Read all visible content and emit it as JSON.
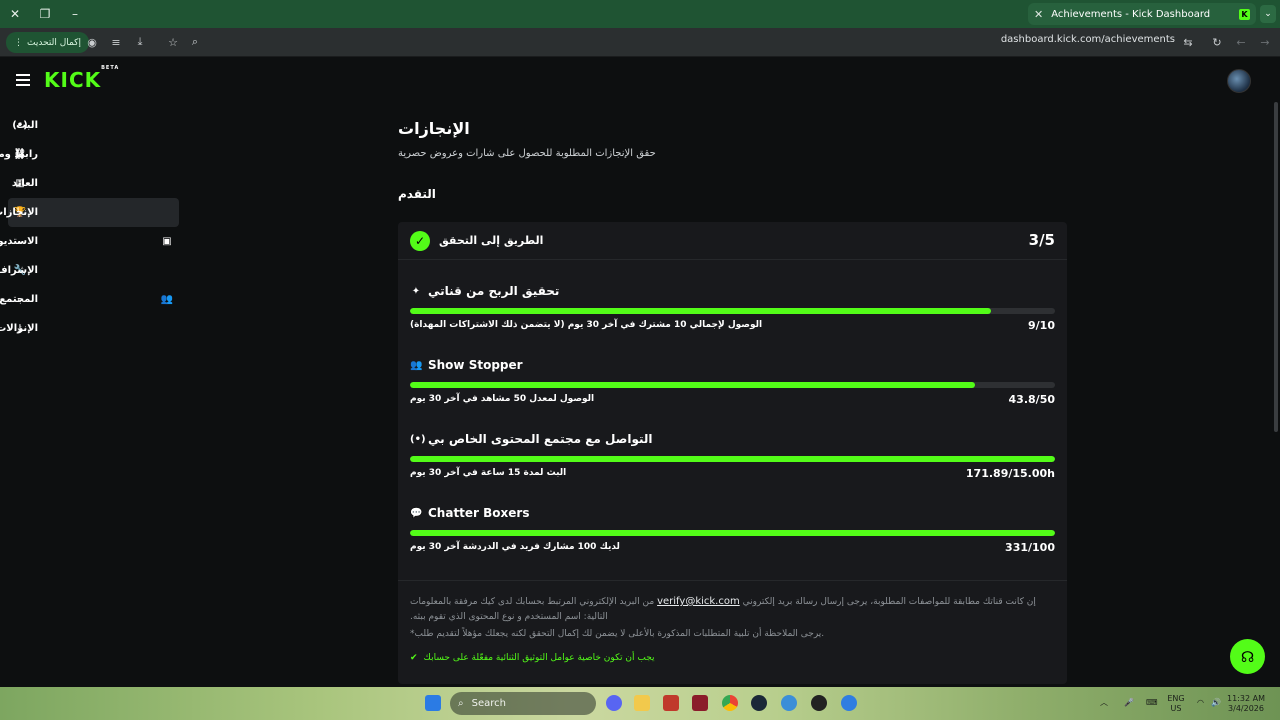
{
  "browser": {
    "tab_title": "Achievements - Kick Dashboard",
    "tab_close": "✕",
    "new_tab": "+",
    "update_label": "إكمال التحديث",
    "url": "dashboard.kick.com/achievements"
  },
  "header": {
    "logo": "KICK",
    "logo_badge": "BETA"
  },
  "sidebar": {
    "items": [
      {
        "label": "البث"
      },
      {
        "label": "رابط ومفتاح البث"
      },
      {
        "label": "العائد"
      },
      {
        "label": "الإنجازات"
      },
      {
        "label": "الاستديو"
      },
      {
        "label": "الإشراف"
      },
      {
        "label": "المجتمع"
      },
      {
        "label": "الإنزالات و الجوائز"
      }
    ]
  },
  "main": {
    "title": "الإنجازات",
    "subtitle": "حقق الإنجازات المطلوبة للحصول على شارات وعروض حصرية",
    "progress_heading": "التقدم",
    "card": {
      "title": "الطريق إلى التحقق",
      "count": "3/5",
      "achievements": [
        {
          "title": "تحقيق الربح من قناتي",
          "progress": 0.9,
          "description": "الوصول لإجمالي 10 مشترك في آخر 30 يوم (لا يتضمن ذلك الاشتراكات المهداة)",
          "value": "9/10"
        },
        {
          "title": "Show Stopper",
          "progress": 0.876,
          "description": "الوصول لمعدل 50 مشاهد في آخر 30 يوم",
          "value": "43.8/50"
        },
        {
          "title": "التواصل مع مجتمع المحتوى الخاص بي",
          "progress": 1.0,
          "description": "البث لمدة 15 ساعة في آخر 30 يوم",
          "value": "171.89/15.00h"
        },
        {
          "title": "Chatter Boxers",
          "progress": 1.0,
          "description": "لديك 100 مشارك فريد في الدردشة آخر 30 يوم",
          "value": "331/100"
        }
      ],
      "note_line1_a": "إن كانت قناتك مطابقة للمواصفات المطلوبة، يرجى إرسال رسالة بريد إلكتروني",
      "note_email": "verify@kick.com",
      "note_line1_b": "من البريد الإلكتروني المرتبط بحسابك لدى كيك مرفقة بالمعلومات التالية: اسم المستخدم و نوع المحتوى الذي تقوم ببثه.",
      "note_line2": "*يرجى الملاحظة أن تلبية المتطلبات المذكورة بالأعلى لا يضمن لك إكمال التحقق لكنه يجعلك مؤهلاً لتقديم طلب.",
      "note_line3": "يجب أن تكون خاصية عوامل التوثيق الثنائية مفعّلة على حسابك"
    }
  },
  "taskbar": {
    "search_placeholder": "Search",
    "lang_top": "ENG",
    "lang_bottom": "US",
    "time": "11:32 AM",
    "date": "3/4/2026"
  },
  "colors": {
    "accent": "#53fc18",
    "background": "#0d0f10",
    "card": "#18191c",
    "browser_frame": "#1f5433"
  }
}
